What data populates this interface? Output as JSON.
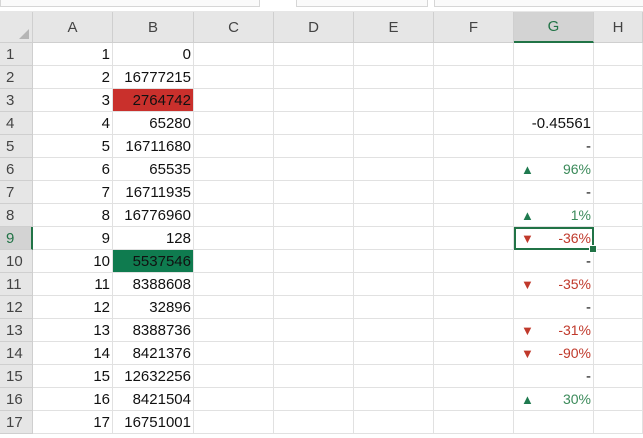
{
  "colors": {
    "fill_red": "#c9302c",
    "fill_green": "#0f7b4f",
    "up_arrow": "#1f7a4f",
    "down_arrow": "#c0392b",
    "pct_positive": "#3b8a5a",
    "pct_negative": "#c0392b"
  },
  "columns": [
    "A",
    "B",
    "C",
    "D",
    "E",
    "F",
    "G",
    "H"
  ],
  "active_column": "G",
  "active_row": 9,
  "rows": [
    {
      "n": "1",
      "a": "1",
      "b": "0"
    },
    {
      "n": "2",
      "a": "2",
      "b": "16777215"
    },
    {
      "n": "3",
      "a": "3",
      "b": "2764742",
      "b_fill": "red"
    },
    {
      "n": "4",
      "a": "4",
      "b": "65280",
      "g": {
        "type": "text",
        "text": "-0.45561"
      }
    },
    {
      "n": "5",
      "a": "5",
      "b": "16711680",
      "g": {
        "type": "dash",
        "text": "-"
      }
    },
    {
      "n": "6",
      "a": "6",
      "b": "65535",
      "g": {
        "type": "up",
        "arrow": "▲",
        "text": "96%"
      }
    },
    {
      "n": "7",
      "a": "7",
      "b": "16711935",
      "g": {
        "type": "dash",
        "text": "-"
      }
    },
    {
      "n": "8",
      "a": "8",
      "b": "16776960",
      "g": {
        "type": "up",
        "arrow": "▲",
        "text": "1%"
      }
    },
    {
      "n": "9",
      "a": "9",
      "b": "128",
      "g": {
        "type": "down",
        "arrow": "▼",
        "text": "-36%"
      }
    },
    {
      "n": "10",
      "a": "10",
      "b": "5537546",
      "b_fill": "green",
      "g": {
        "type": "dash",
        "text": "-"
      }
    },
    {
      "n": "11",
      "a": "11",
      "b": "8388608",
      "g": {
        "type": "down",
        "arrow": "▼",
        "text": "-35%"
      }
    },
    {
      "n": "12",
      "a": "12",
      "b": "32896",
      "g": {
        "type": "dash",
        "text": "-"
      }
    },
    {
      "n": "13",
      "a": "13",
      "b": "8388736",
      "g": {
        "type": "down",
        "arrow": "▼",
        "text": "-31%"
      }
    },
    {
      "n": "14",
      "a": "14",
      "b": "8421376",
      "g": {
        "type": "down",
        "arrow": "▼",
        "text": "-90%"
      }
    },
    {
      "n": "15",
      "a": "15",
      "b": "12632256",
      "g": {
        "type": "dash",
        "text": "-"
      }
    },
    {
      "n": "16",
      "a": "16",
      "b": "8421504",
      "g": {
        "type": "up",
        "arrow": "▲",
        "text": "30%"
      }
    },
    {
      "n": "17",
      "a": "17",
      "b": "16751001"
    }
  ]
}
